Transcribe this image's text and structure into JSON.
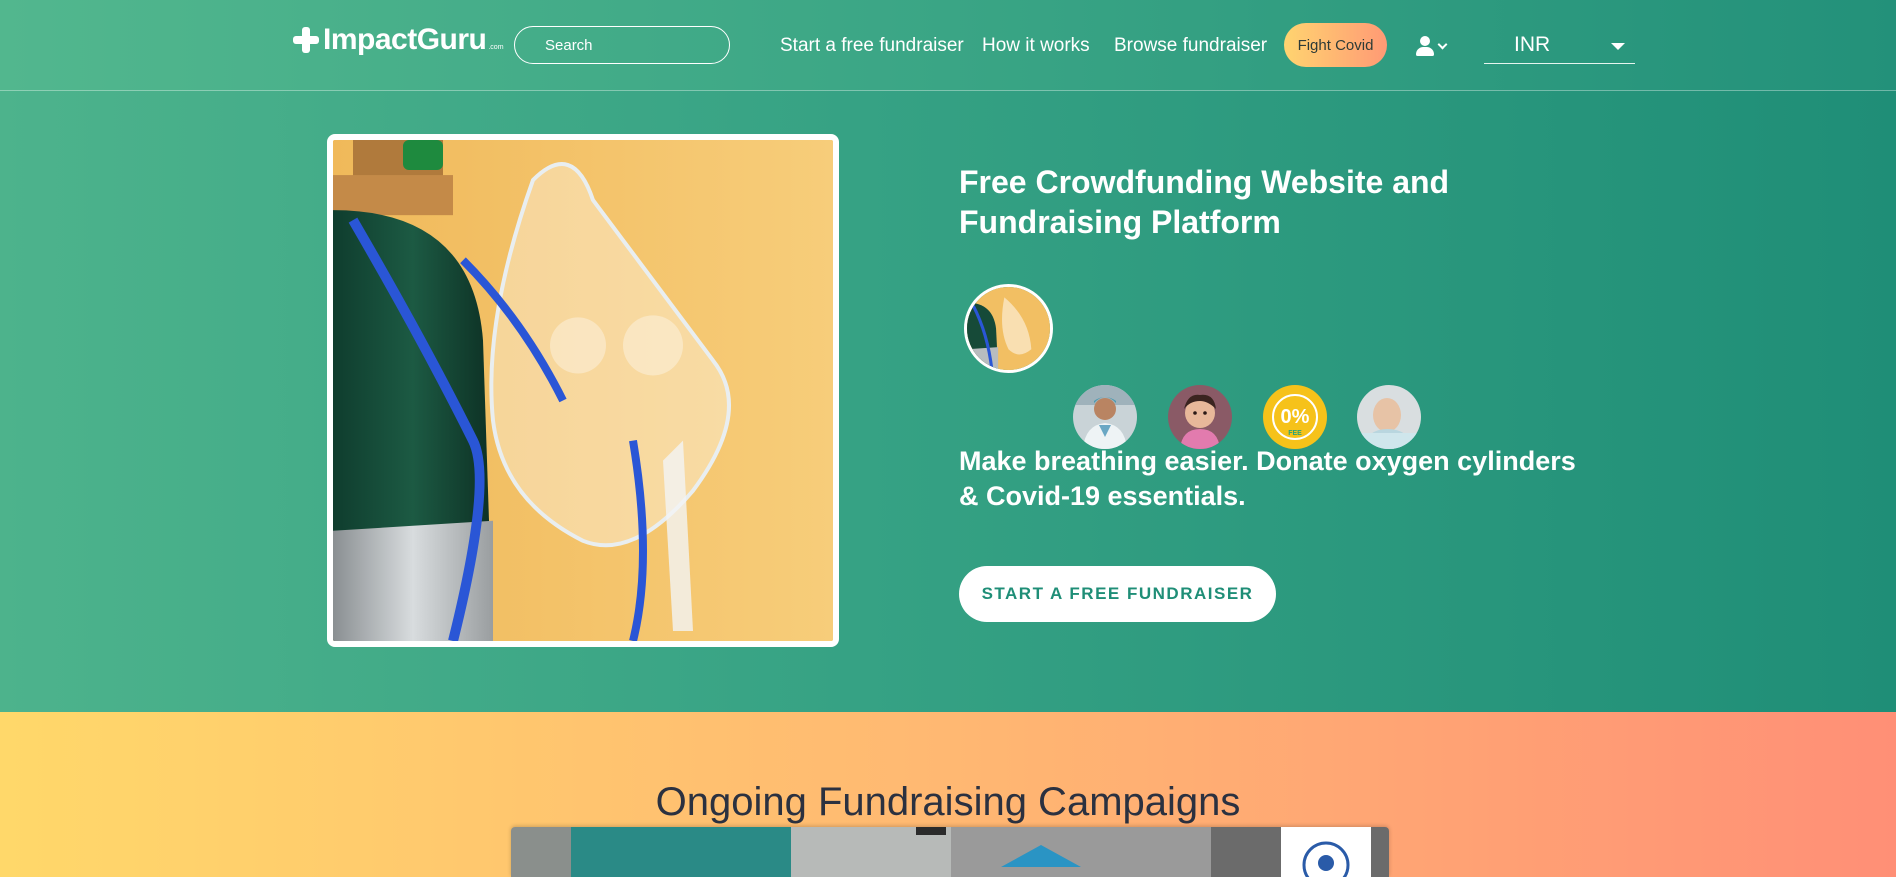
{
  "header": {
    "logo_text": "ImpactGuru",
    "logo_sub": ".com",
    "search_placeholder": "Search",
    "nav": [
      {
        "label": "Start a free fundraiser"
      },
      {
        "label": "How it works"
      },
      {
        "label": "Browse fundraiser"
      }
    ],
    "fight_covid_label": "Fight Covid",
    "user_icon": "user-icon",
    "currency": "INR"
  },
  "hero": {
    "title": "Free Crowdfunding Website and Fundraising Platform",
    "tagline": "Make breathing easier. Donate oxygen cylinders & Covid-19 essentials.",
    "cta_label": "START A FREE FUNDRAISER",
    "thumb_fee_text": "0%",
    "thumb_fee_sub": "FEE"
  },
  "ongoing": {
    "title": "Ongoing Fundraising Campaigns"
  },
  "colors": {
    "hero_green": "#2a9a7f",
    "accent_orange": "#ffb872",
    "cta_text": "#1f8e77"
  }
}
